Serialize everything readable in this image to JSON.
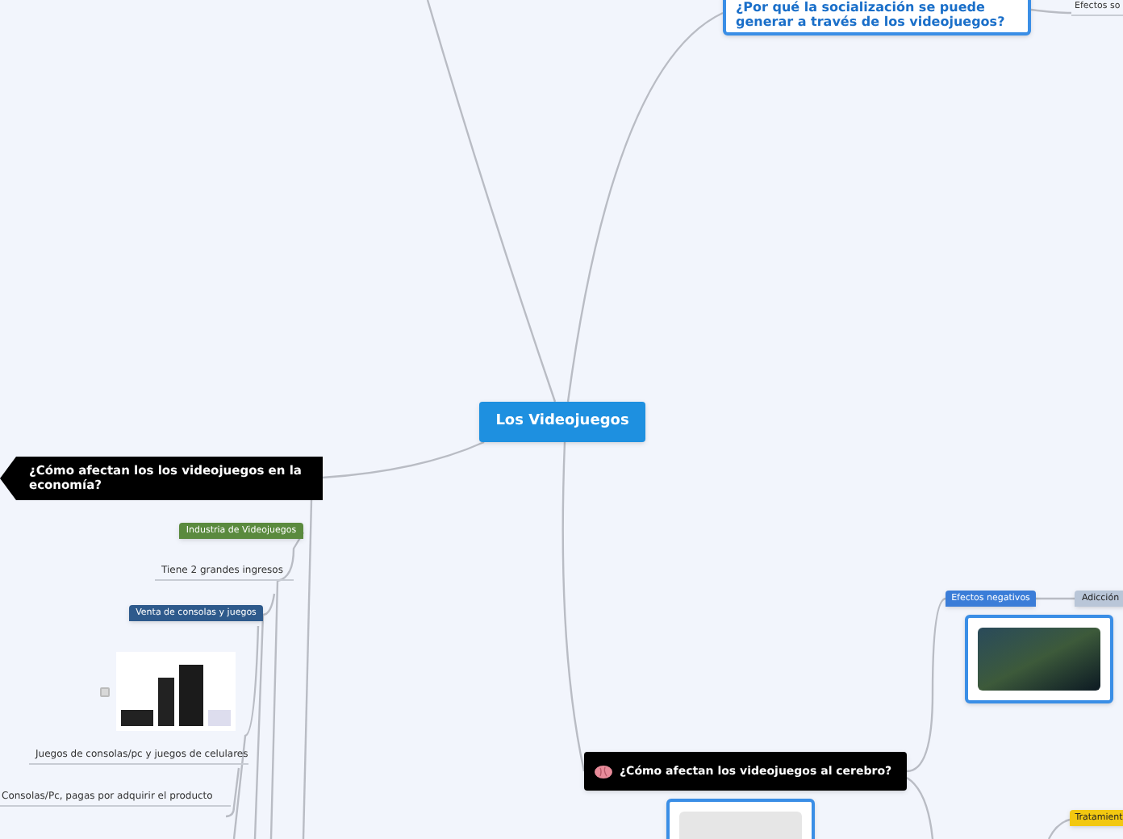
{
  "central": {
    "label": "Los Videojuegos"
  },
  "nodes": [
    {
      "kind": "question",
      "label": "¿Por qué la socialización se puede generar a través de los videojuegos?"
    },
    {
      "kind": "text",
      "label": "Efectos so"
    },
    {
      "kind": "flag",
      "label": "¿Cómo afectan los los videojuegos en la economía?"
    },
    {
      "kind": "tag",
      "label": "Industria de Videojuegos",
      "color": "#5a8a3e"
    },
    {
      "kind": "text",
      "label": "Tiene 2 grandes ingresos"
    },
    {
      "kind": "tag",
      "label": "Venta de consolas y juegos",
      "color": "#2e5a8c"
    },
    {
      "kind": "image",
      "checked": false
    },
    {
      "kind": "text",
      "label": "Juegos de consolas/pc y juegos de celulares"
    },
    {
      "kind": "text",
      "label": "Consolas/Pc, pagas por adquirir el producto"
    },
    {
      "kind": "dark",
      "label": "¿Cómo afectan los videojuegos al cerebro?"
    },
    {
      "kind": "tag",
      "label": "Efectos negativos",
      "color": "#3b7dd8"
    },
    {
      "kind": "tag",
      "label": "Adicción",
      "color": "#b9c6d8"
    },
    {
      "kind": "image"
    },
    {
      "kind": "image"
    },
    {
      "kind": "tag",
      "label": "Tratamient",
      "color": "#f2c811"
    }
  ]
}
